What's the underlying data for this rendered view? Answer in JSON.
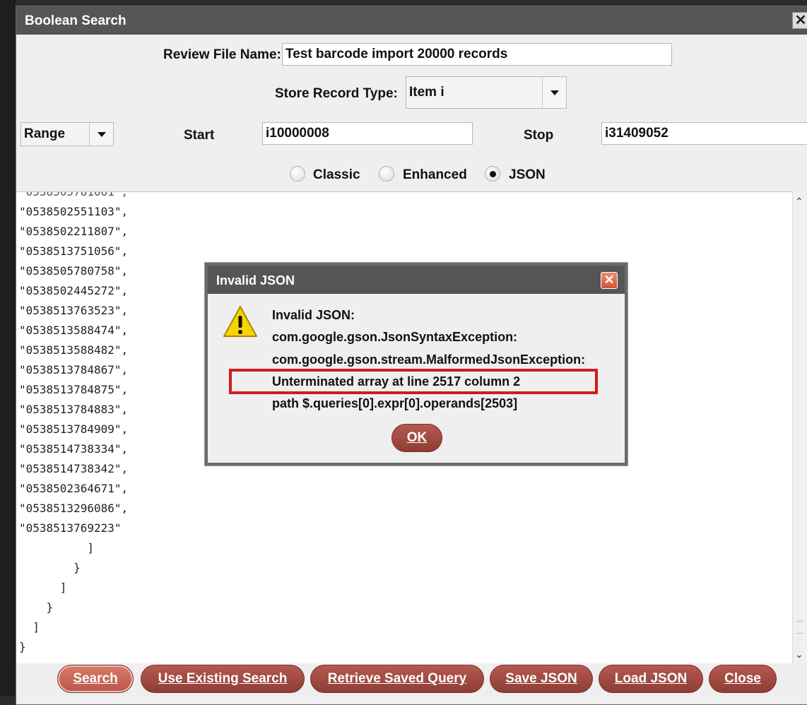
{
  "window": {
    "title": "Boolean Search",
    "close_glyph": "✕"
  },
  "form": {
    "review_file_label": "Review File Name:",
    "review_file_value": "Test barcode import 20000 records",
    "store_record_type_label": "Store Record Type:",
    "store_record_type_value": "Item  i",
    "range_select_value": "Range",
    "start_label": "Start",
    "start_value": "i10000008",
    "stop_label": "Stop",
    "stop_value": "i31409052",
    "modes": [
      {
        "label": "Classic",
        "selected": false
      },
      {
        "label": "Enhanced",
        "selected": false
      },
      {
        "label": "JSON",
        "selected": true
      }
    ]
  },
  "editor": {
    "lines": [
      "\"0538502551103\",",
      "\"0538502211807\",",
      "\"0538513751056\",",
      "\"0538505780758\",",
      "\"0538502445272\",",
      "\"0538513763523\",",
      "\"0538513588474\",",
      "\"0538513588482\",",
      "\"0538513784867\",",
      "\"0538513784875\",",
      "\"0538513784883\",",
      "\"0538513784909\",",
      "\"0538514738334\",",
      "\"0538514738342\",",
      "\"0538502364671\",",
      "\"0538513296086\",",
      "\"0538513769223\"",
      "          ]",
      "        }",
      "      ]",
      "    }",
      "  ]",
      "}"
    ]
  },
  "buttons": {
    "search": "Search",
    "use_existing": "Use Existing Search",
    "retrieve_saved": "Retrieve Saved Query",
    "save_json": "Save JSON",
    "load_json": "Load JSON",
    "close": "Close"
  },
  "dialog": {
    "title": "Invalid JSON",
    "close_glyph": "✕",
    "icon": "warning-icon",
    "messages": [
      "Invalid JSON:",
      "com.google.gson.JsonSyntaxException:",
      "com.google.gson.stream.MalformedJsonException:",
      "Unterminated array at line 2517 column 2",
      "path $.queries[0].expr[0].operands[2503]"
    ],
    "ok_label": "OK",
    "highlight_color": "#d21a1a"
  },
  "colors": {
    "titlebar": "#555555",
    "button": "#9c463d"
  }
}
